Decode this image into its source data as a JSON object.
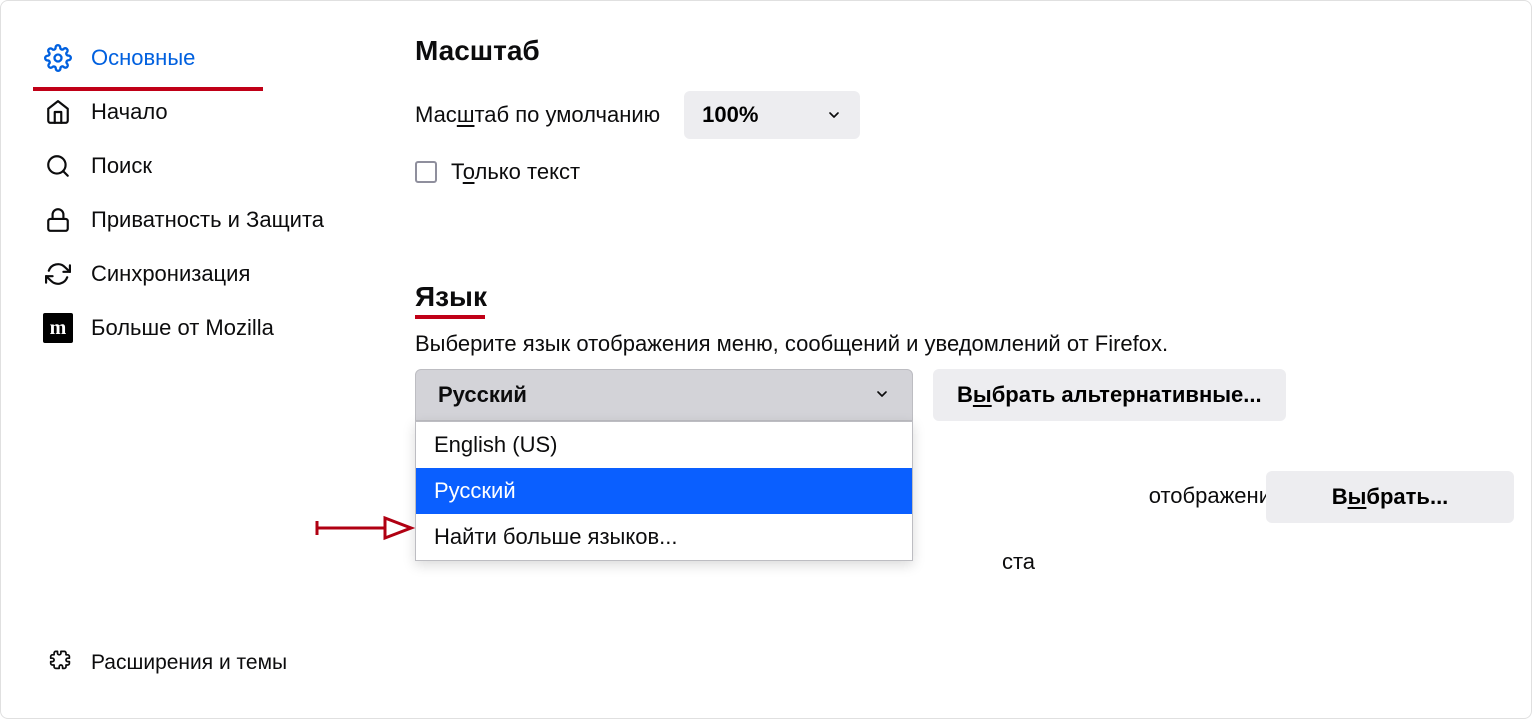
{
  "sidebar": {
    "items": [
      {
        "label": "Основные"
      },
      {
        "label": "Начало"
      },
      {
        "label": "Поиск"
      },
      {
        "label": "Приватность и Защита"
      },
      {
        "label": "Синхронизация"
      },
      {
        "label": "Больше от Mozilla"
      }
    ],
    "extensions": "Расширения и темы"
  },
  "zoom": {
    "title": "Масштаб",
    "default_label_pre": "Мас",
    "default_label_u": "ш",
    "default_label_post": "таб по умолчанию",
    "value": "100%",
    "text_only_pre": "Т",
    "text_only_u": "о",
    "text_only_post": "лько текст"
  },
  "language": {
    "title": "Язык",
    "description": "Выберите язык отображения меню, сообщений и уведомлений от Firefox.",
    "selected": "Русский",
    "alt_button_pre": "В",
    "alt_button_u": "ы",
    "alt_button_post": "брать альтернативные...",
    "options": [
      {
        "label": "English (US)"
      },
      {
        "label": "Русский"
      },
      {
        "label": "Найти больше языков..."
      }
    ]
  },
  "behind": {
    "pages_text": "отображения страниц",
    "text_fragment": "ста",
    "choose_pre": "В",
    "choose_u": "ы",
    "choose_post": "брать..."
  }
}
